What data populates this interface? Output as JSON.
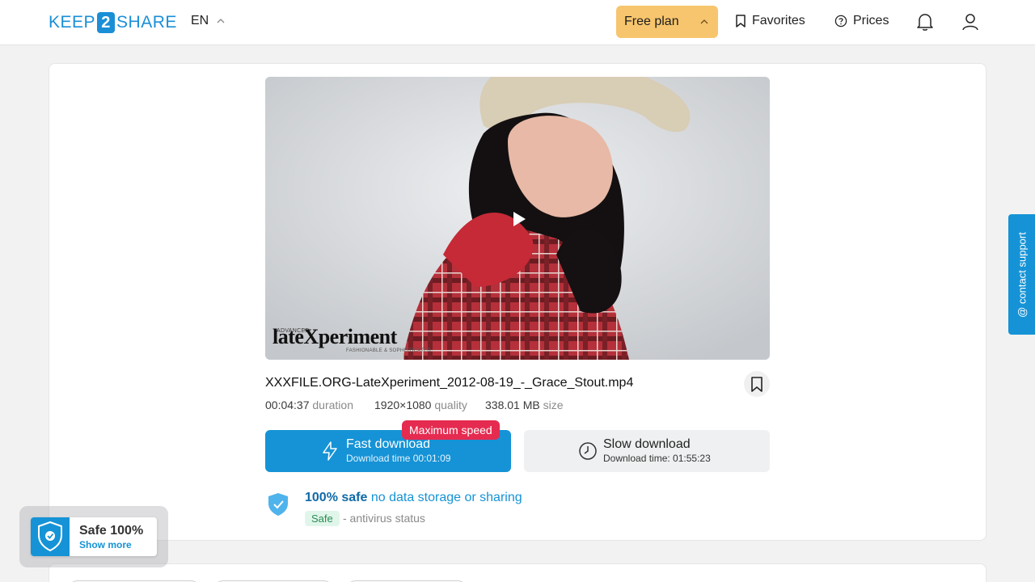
{
  "header": {
    "logo_left": "KEEP",
    "logo_mid": "2",
    "logo_right": "SHARE",
    "language": "EN",
    "plan_label": "Free plan",
    "favorites_label": "Favorites",
    "prices_label": "Prices"
  },
  "video": {
    "watermark_small": "ADVANCED",
    "watermark_main": "lateXperiment",
    "watermark_sub": "FASHIONABLE & SOPHISTICATED"
  },
  "file": {
    "name": "XXXFILE.ORG-LateXperiment_2012-08-19_-_Grace_Stout.mp4",
    "duration_value": "00:04:37",
    "duration_label": "duration",
    "quality_value": "1920×1080",
    "quality_label": "quality",
    "size_value": "338.01 MB",
    "size_label": "size"
  },
  "downloads": {
    "badge": "Maximum speed",
    "fast_title": "Fast download",
    "fast_time": "Download time 00:01:09",
    "slow_title": "Slow download",
    "slow_time": "Download time: 01:55:23"
  },
  "safety": {
    "bold": "100% safe",
    "rest": "no data storage or sharing",
    "tag": "Safe",
    "status": "- antivirus status"
  },
  "support_label": "@ contact support",
  "widget": {
    "title": "Safe 100%",
    "link": "Show more"
  },
  "colors": {
    "accent": "#1593d6",
    "plan": "#f7c56d",
    "badge": "#e52b50"
  }
}
